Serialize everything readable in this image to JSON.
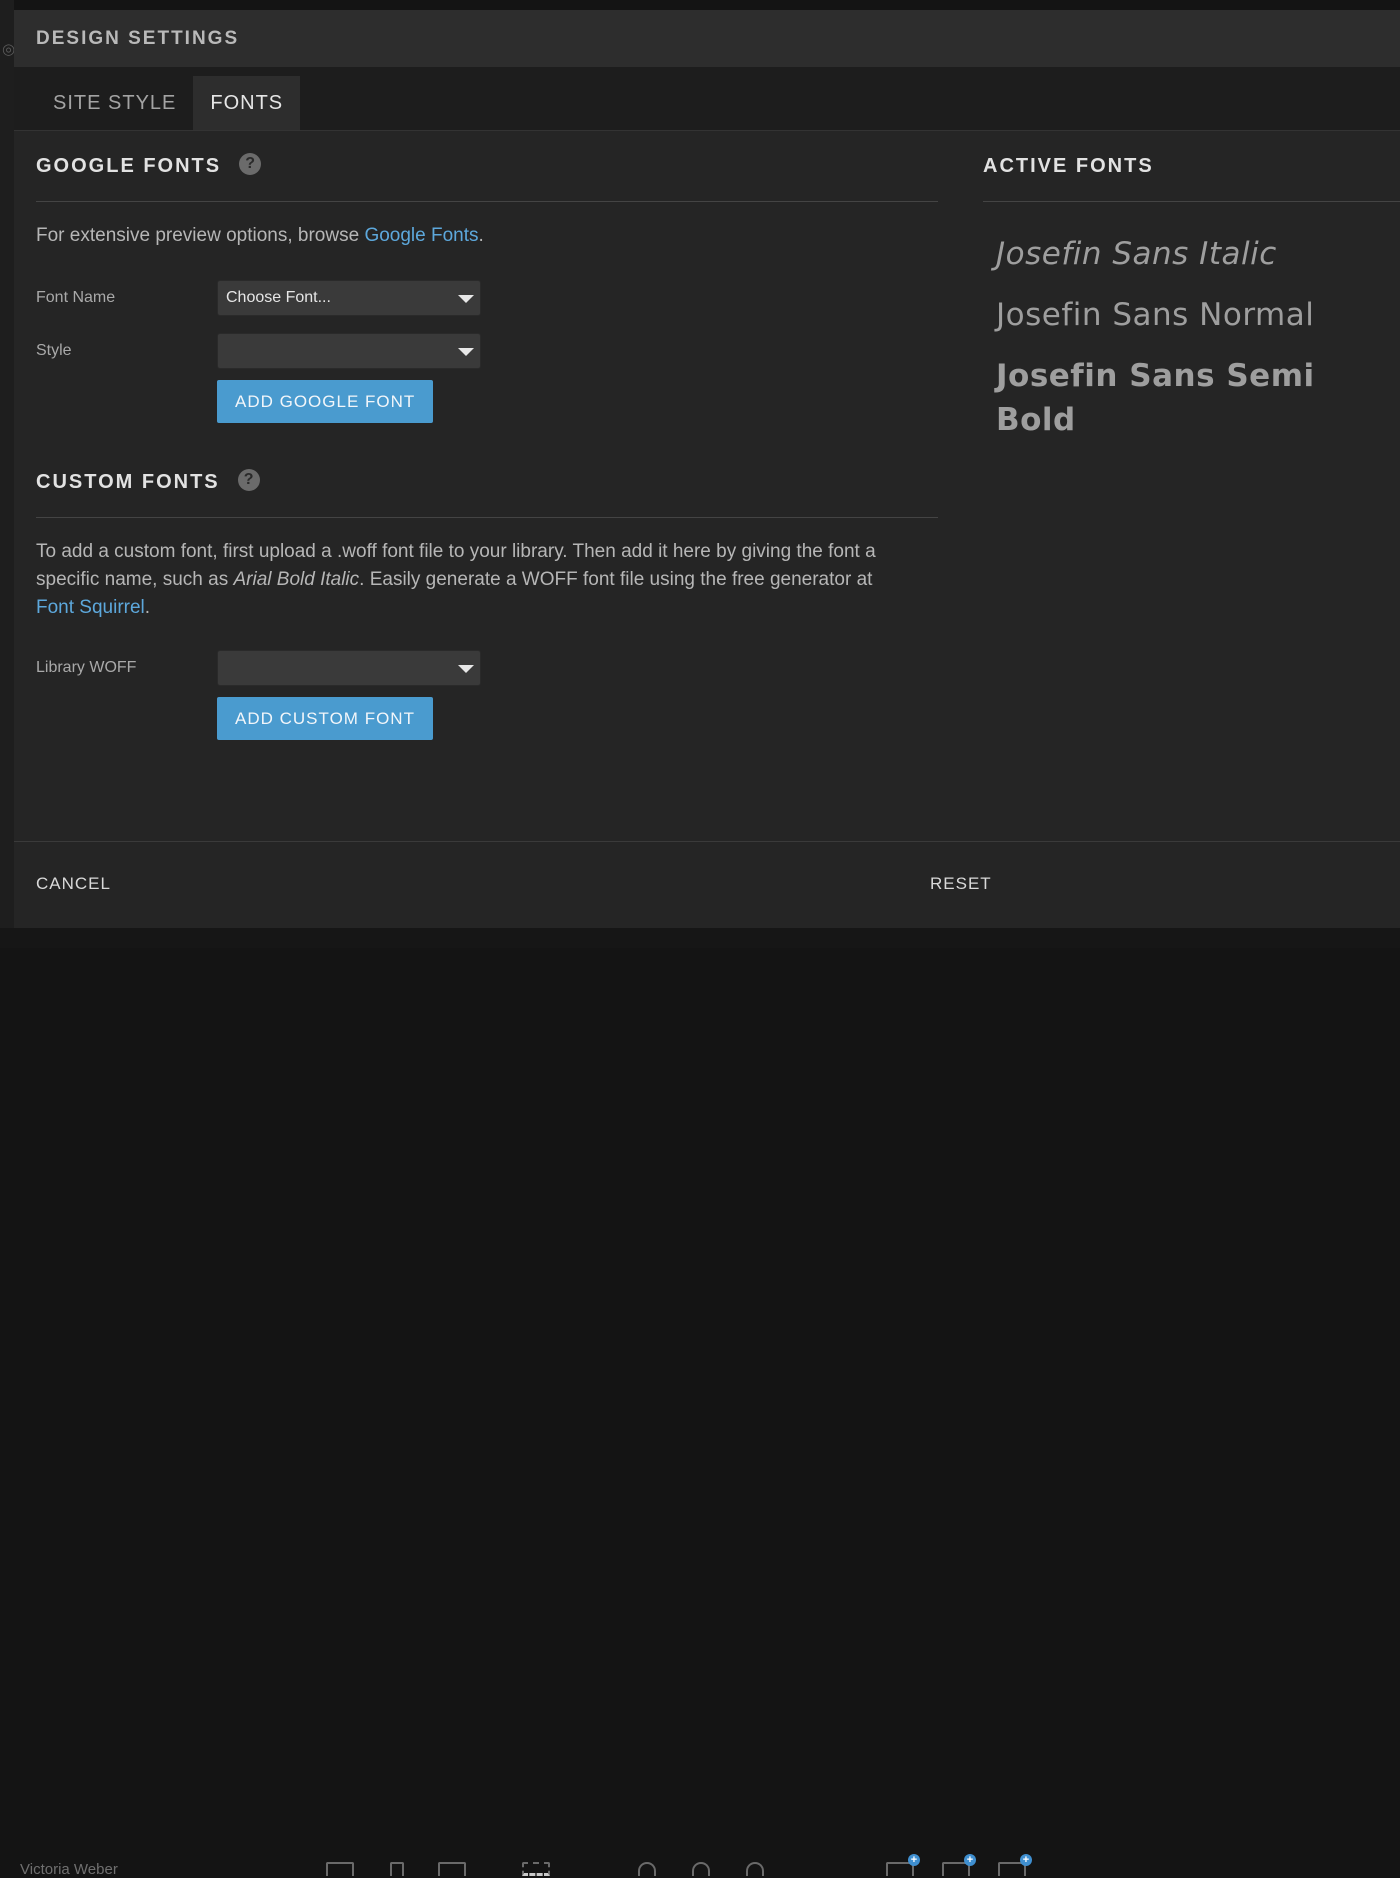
{
  "background": {
    "user_name": "Victoria Weber"
  },
  "dialog": {
    "title": "DESIGN SETTINGS",
    "tabs": [
      {
        "label": "SITE STYLE",
        "active": false
      },
      {
        "label": "FONTS",
        "active": true
      }
    ]
  },
  "google_fonts": {
    "title": "GOOGLE FONTS",
    "help": "?",
    "desc_prefix": "For extensive preview options, browse ",
    "desc_link": "Google Fonts",
    "desc_suffix": ".",
    "font_name_label": "Font Name",
    "font_name_value": "Choose Font...",
    "style_label": "Style",
    "style_value": "",
    "add_button": "ADD GOOGLE FONT"
  },
  "custom_fonts": {
    "title": "CUSTOM FONTS",
    "help": "?",
    "desc_1": "To add a custom font, first upload a .woff font file to your library. Then add it here by giving the font a specific name, such as ",
    "desc_example": "Arial Bold Italic",
    "desc_2": ". Easily generate a WOFF font file using the free generator at ",
    "desc_link": "Font Squirrel",
    "desc_end": ".",
    "library_label": "Library WOFF",
    "library_value": "",
    "add_button": "ADD CUSTOM FONT"
  },
  "active_fonts": {
    "title": "ACTIVE FONTS",
    "items": [
      {
        "name": "Josefin Sans Italic",
        "style": "italic"
      },
      {
        "name": "Josefin Sans Normal",
        "style": "normal"
      },
      {
        "name": "Josefin Sans Semi Bold",
        "style": "bold"
      }
    ]
  },
  "footer": {
    "cancel": "CANCEL",
    "reset": "RESET"
  },
  "colors": {
    "accent": "#4a9bcf",
    "link": "#5da8dc",
    "dialog_bg": "#252525"
  }
}
